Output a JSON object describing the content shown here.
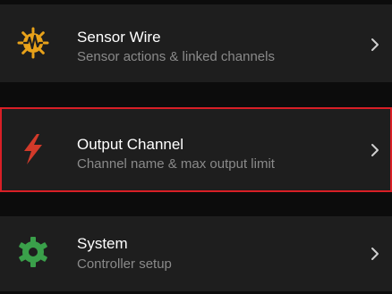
{
  "colors": {
    "background": "#0c0c0c",
    "row_background": "#1e1e1e",
    "selection_border": "#d81f26",
    "sensor_icon": "#e8a21a",
    "output_icon": "#d23a2a",
    "system_icon": "#3aa04a",
    "title_text": "#ffffff",
    "subtitle_text": "#8a8a8a"
  },
  "menu": {
    "items": [
      {
        "title": "Sensor Wire",
        "subtitle": "Sensor actions & linked channels",
        "icon": "sensor-waveform-icon",
        "chevron": ">"
      },
      {
        "title": "Output Channel",
        "subtitle": "Channel name & max output limit",
        "icon": "lightning-bolt-icon",
        "chevron": ">",
        "selected": true
      },
      {
        "title": "System",
        "subtitle": "Controller setup",
        "icon": "gear-icon",
        "chevron": ">"
      }
    ]
  }
}
